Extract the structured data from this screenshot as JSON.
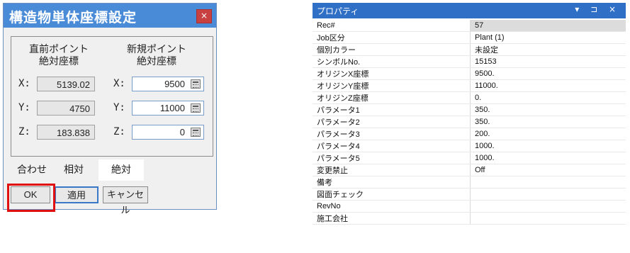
{
  "dialog": {
    "title": "構造物単体座標設定",
    "close_glyph": "×",
    "prev_header_line1": "直前ポイント",
    "prev_header_line2": "絶対座標",
    "new_header_line1": "新規ポイント",
    "new_header_line2": "絶対座標",
    "rows": [
      {
        "axis": "X:",
        "prev": "5139.02",
        "new": "9500"
      },
      {
        "axis": "Y:",
        "prev": "4750",
        "new": "11000"
      },
      {
        "axis": "Z:",
        "prev": "183.838",
        "new": "0"
      }
    ],
    "tabs": [
      {
        "label": "合わせ",
        "active": false
      },
      {
        "label": "相対",
        "active": false
      },
      {
        "label": "絶対",
        "active": true
      }
    ],
    "buttons": {
      "ok": "OK",
      "apply": "適用",
      "cancel": "キャンセル"
    },
    "highlight_color": "#e01010"
  },
  "properties": {
    "title": "プロパティ",
    "title_icons": "▾ ⊐ ×",
    "rows": [
      {
        "key": "Rec#",
        "value": "57"
      },
      {
        "key": "Job区分",
        "value": "Plant (1)"
      },
      {
        "key": "個別カラー",
        "value": "未設定"
      },
      {
        "key": "シンボルNo.",
        "value": "15153"
      },
      {
        "key": "オリジンX座標",
        "value": "9500."
      },
      {
        "key": "オリジンY座標",
        "value": "11000."
      },
      {
        "key": "オリジンZ座標",
        "value": "0."
      },
      {
        "key": "パラメータ1",
        "value": "350."
      },
      {
        "key": "パラメータ2",
        "value": "350."
      },
      {
        "key": "パラメータ3",
        "value": "200."
      },
      {
        "key": "パラメータ4",
        "value": "1000."
      },
      {
        "key": "パラメータ5",
        "value": "1000."
      },
      {
        "key": "変更禁止",
        "value": "Off"
      },
      {
        "key": "備考",
        "value": ""
      },
      {
        "key": "図面チェック",
        "value": ""
      },
      {
        "key": "RevNo",
        "value": ""
      },
      {
        "key": "施工会社",
        "value": ""
      }
    ],
    "header_color": "#2f6fc6"
  }
}
